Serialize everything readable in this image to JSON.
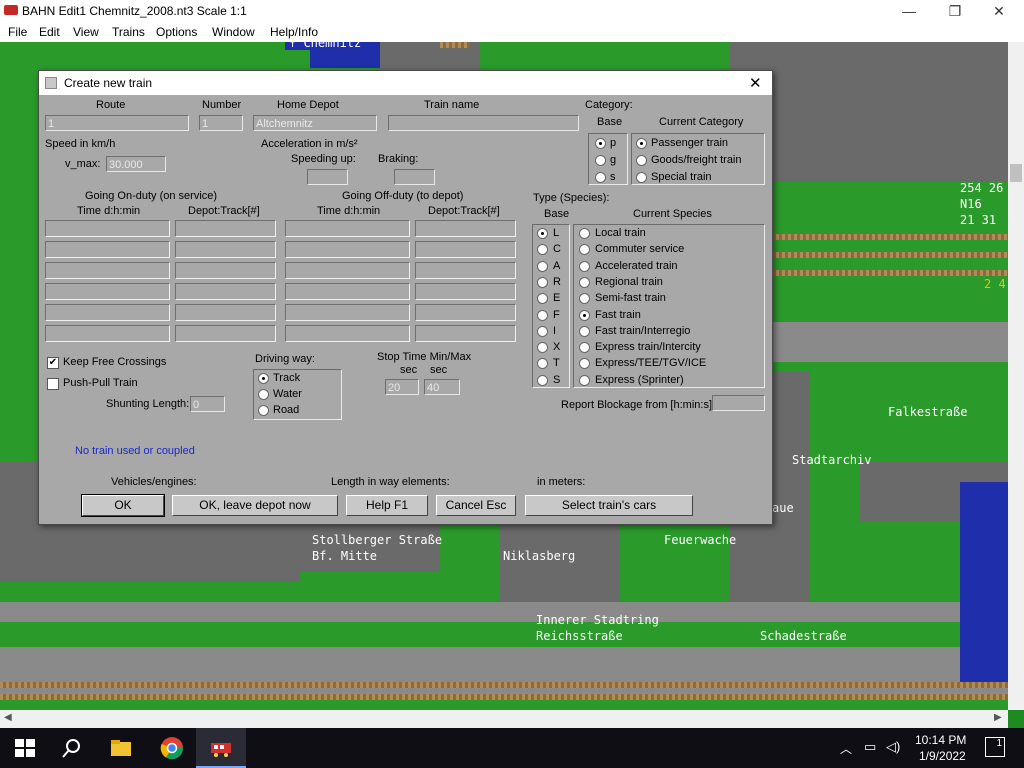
{
  "app": {
    "title": "BAHN Edit1 Chemnitz_2008.nt3 Scale 1:1",
    "minimize": "—",
    "maximize": "❐",
    "close": "✕"
  },
  "menu": [
    "File",
    "Edit",
    "View",
    "Trains",
    "Options",
    "Window",
    "Help/Info"
  ],
  "map_labels": {
    "chemnitz": "↑ Chemnitz",
    "stollberger": "Stollberger Straße",
    "bf_mitte": "Bf. Mitte",
    "niklasberg": "Niklasberg",
    "feuerwache": "Feuerwache",
    "innerer": "Innerer Stadtring",
    "reichs": "Reichsstraße",
    "schade": "Schadestraße",
    "falke": "Falkestraße",
    "stadtarchiv": "Stadtarchiv",
    "aue": "aue",
    "code1": "254 26",
    "code2": "N16",
    "code3": "21 31",
    "code4": "2 4"
  },
  "dialog": {
    "title": "Create new train",
    "close": "✕",
    "headers": {
      "route": "Route",
      "number": "Number",
      "home_depot": "Home Depot",
      "train_name": "Train name",
      "category": "Category:",
      "base": "Base",
      "current_category": "Current Category"
    },
    "fields": {
      "route": "1",
      "number": "1",
      "home_depot": "Altchemnitz",
      "train_name": "",
      "vmax": "30.000",
      "speeding_up": "",
      "braking": "",
      "shunting_length": "0",
      "stop_min": "20",
      "stop_max": "40",
      "report_blockage": ""
    },
    "speed_label": "Speed in km/h",
    "vmax_label": "v_max:",
    "accel_label": "Acceleration in m/s²",
    "speeding_label": "Speeding up:",
    "braking_label": "Braking:",
    "category_base": [
      {
        "label": "p",
        "selected": true
      },
      {
        "label": "g",
        "selected": false
      },
      {
        "label": "s",
        "selected": false
      }
    ],
    "category_current": [
      {
        "label": "Passenger train",
        "selected": true
      },
      {
        "label": "Goods/freight train",
        "selected": false
      },
      {
        "label": "Special train",
        "selected": false
      }
    ],
    "onduty_label": "Going On-duty (on service)",
    "offduty_label": "Going Off-duty (to depot)",
    "time_label": "Time   d:h:min",
    "depot_track_label": "Depot:Track[#]",
    "type_label": "Type (Species):",
    "type_base_label": "Base",
    "current_species_label": "Current Species",
    "species_base": [
      {
        "label": "L",
        "selected": true
      },
      {
        "label": "C",
        "selected": false
      },
      {
        "label": "A",
        "selected": false
      },
      {
        "label": "R",
        "selected": false
      },
      {
        "label": "E",
        "selected": false
      },
      {
        "label": "F",
        "selected": false
      },
      {
        "label": "I",
        "selected": false
      },
      {
        "label": "X",
        "selected": false
      },
      {
        "label": "T",
        "selected": false
      },
      {
        "label": "S",
        "selected": false
      }
    ],
    "species_current": [
      {
        "label": "Local train",
        "selected": false
      },
      {
        "label": "Commuter service",
        "selected": false
      },
      {
        "label": "Accelerated train",
        "selected": false
      },
      {
        "label": "Regional train",
        "selected": false
      },
      {
        "label": "Semi-fast train",
        "selected": false
      },
      {
        "label": "Fast train",
        "selected": true
      },
      {
        "label": "Fast train/Interregio",
        "selected": false
      },
      {
        "label": "Express train/Intercity",
        "selected": false
      },
      {
        "label": "Express/TEE/TGV/ICE",
        "selected": false
      },
      {
        "label": "Express (Sprinter)",
        "selected": false
      }
    ],
    "keep_free_crossings": {
      "label": "Keep Free Crossings",
      "checked": true
    },
    "push_pull": {
      "label": "Push-Pull Train",
      "checked": false
    },
    "shunting_label": "Shunting Length:",
    "driving_way_label": "Driving way:",
    "driving_way": [
      {
        "label": "Track",
        "selected": true
      },
      {
        "label": "Water",
        "selected": false
      },
      {
        "label": "Road",
        "selected": false
      }
    ],
    "stop_time_label": "Stop Time Min/Max",
    "sec_label": "sec",
    "report_label": "Report Blockage from [h:min:s]:",
    "no_train": "No train used or coupled",
    "vehicles_label": "Vehicles/engines:",
    "length_label": "Length in way elements:",
    "meters_label": "in meters:",
    "buttons": {
      "ok": "OK",
      "ok_leave": "OK, leave depot now",
      "help": "Help       F1",
      "cancel": "Cancel    Esc",
      "select_cars": "Select train's cars"
    }
  },
  "taskbar": {
    "time": "10:14 PM",
    "date": "1/9/2022",
    "notifications": "1"
  }
}
